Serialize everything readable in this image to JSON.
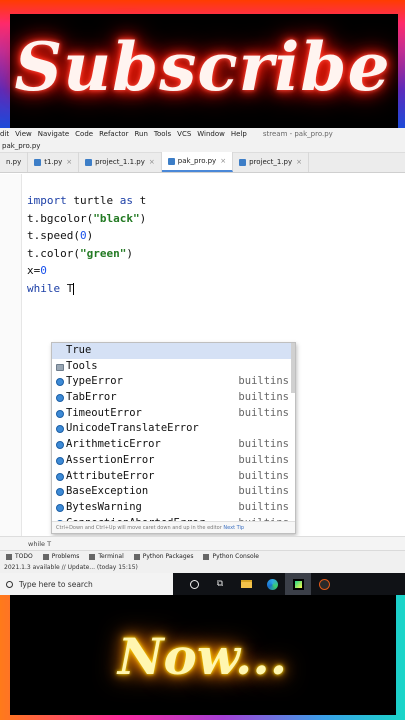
{
  "banner_top": {
    "text": "Subscribe"
  },
  "banner_bottom": {
    "text": "Now..."
  },
  "menu": {
    "items": [
      "dit",
      "View",
      "Navigate",
      "Code",
      "Refactor",
      "Run",
      "Tools",
      "VCS",
      "Window",
      "Help"
    ],
    "window_title": "stream - pak_pro.py"
  },
  "breadcrumb": {
    "file": "pak_pro.py"
  },
  "tabs": [
    {
      "label": "n.py",
      "active": false
    },
    {
      "label": "t1.py",
      "active": false
    },
    {
      "label": "project_1.1.py",
      "active": false
    },
    {
      "label": "pak_pro.py",
      "active": true
    },
    {
      "label": "project_1.py",
      "active": false
    }
  ],
  "code": {
    "line1_kw": "import",
    "line1_rest": " turtle ",
    "line1_kw2": "as",
    "line1_end": " t",
    "line2_pre": "t.bgcolor(",
    "line2_str": "\"black\"",
    "line2_post": ")",
    "line3_pre": "t.speed(",
    "line3_num": "0",
    "line3_post": ")",
    "line4_pre": "t.color(",
    "line4_str": "\"green\"",
    "line4_post": ")",
    "line5_pre": "x=",
    "line5_num": "0",
    "line6_kw": "while",
    "line6_rest": " T"
  },
  "autocomplete": {
    "items": [
      {
        "label": "True",
        "source": "",
        "kind": "keyword"
      },
      {
        "label": "Tools",
        "source": "",
        "kind": "folder"
      },
      {
        "label": "TypeError",
        "source": "builtins",
        "kind": "class"
      },
      {
        "label": "TabError",
        "source": "builtins",
        "kind": "class"
      },
      {
        "label": "TimeoutError",
        "source": "builtins",
        "kind": "class"
      },
      {
        "label": "UnicodeTranslateError",
        "source": "builtins",
        "kind": "class"
      },
      {
        "label": "ArithmeticError",
        "source": "builtins",
        "kind": "class"
      },
      {
        "label": "AssertionError",
        "source": "builtins",
        "kind": "class"
      },
      {
        "label": "AttributeError",
        "source": "builtins",
        "kind": "class"
      },
      {
        "label": "BaseException",
        "source": "builtins",
        "kind": "class"
      },
      {
        "label": "BytesWarning",
        "source": "builtins",
        "kind": "class"
      },
      {
        "label": "ConnectionAbortedError",
        "source": "builtins",
        "kind": "class"
      }
    ],
    "hint": "Ctrl+Down and Ctrl+Up will move caret down and up in the editor",
    "hint_link": "Next Tip"
  },
  "status_context": "while T",
  "tool_windows": [
    "TODO",
    "Problems",
    "Terminal",
    "Python Packages",
    "Python Console"
  ],
  "info_message": "2021.1.3 available // Update... (today 15:15)",
  "taskbar": {
    "search_placeholder": "Type here to search"
  }
}
